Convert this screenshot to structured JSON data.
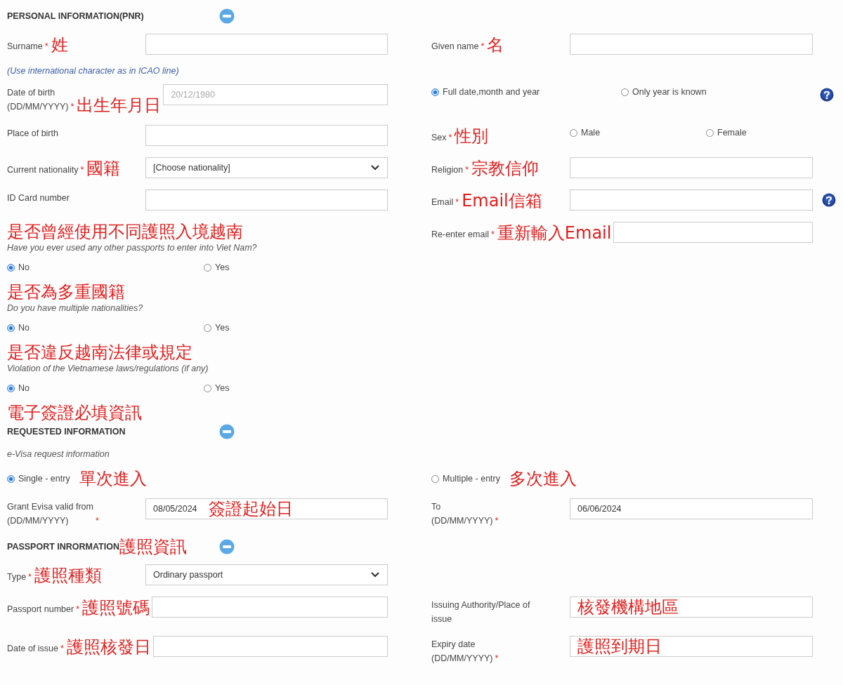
{
  "sections": [
    {
      "title": "PERSONAL INFORMATION(PNR)",
      "expanded": true,
      "rows": [
        {
          "kind": "pair",
          "cells": [
            {
              "kind": "input",
              "label": "Surname",
              "required_mark": "*",
              "note": "姓"
            },
            {
              "kind": "input",
              "label": "Given name",
              "required_mark": "*",
              "note": "名"
            }
          ]
        },
        {
          "kind": "info_hint",
          "text": "(Use international character as in ICAO line)"
        },
        {
          "kind": "pair",
          "cells": [
            {
              "kind": "input",
              "label": "Date of birth\n(DD/MM/YYYY)",
              "required_mark": "*",
              "note": "出生年月日",
              "placeholder": "20/12/1980"
            },
            {
              "kind": "choice",
              "help": true,
              "options": [
                {
                  "label": "Full date,month and year",
                  "selected": true
                },
                {
                  "label": "Only year is known",
                  "selected": false
                }
              ]
            }
          ]
        },
        {
          "kind": "pair",
          "cells": [
            {
              "kind": "input",
              "label": "Place of birth"
            },
            {
              "kind": "choice",
              "label": "Sex",
              "required_mark": "*",
              "note": "性別",
              "options": [
                {
                  "label": "Male",
                  "selected": false
                },
                {
                  "label": "Female",
                  "selected": false
                }
              ]
            }
          ]
        },
        {
          "kind": "pair",
          "cells": [
            {
              "kind": "select",
              "label": "Current nationality",
              "required_mark": "*",
              "note": "國籍",
              "value": "[Choose nationality]"
            },
            {
              "kind": "input",
              "label": "Religion",
              "required_mark": "*",
              "note": "宗教信仰"
            }
          ]
        },
        {
          "kind": "pair",
          "cells": [
            {
              "kind": "input",
              "label": "ID Card number"
            },
            {
              "kind": "input",
              "label": "Email",
              "required_mark": "*",
              "note": "Email信箱",
              "help": true
            }
          ]
        },
        {
          "kind": "pair",
          "cells": [
            {
              "kind": "question",
              "note": "是否曾經使用不同護照入境越南",
              "text": "Have you ever used any other passports to enter into Viet Nam?",
              "options": [
                {
                  "label": "No",
                  "selected": true
                },
                {
                  "label": "Yes",
                  "selected": false
                }
              ]
            },
            {
              "kind": "input",
              "label": "Re-enter email",
              "required_mark": "*",
              "note": "重新輸入Email"
            }
          ]
        },
        {
          "kind": "pair",
          "cells": [
            {
              "kind": "question",
              "note": "是否為多重國籍",
              "text": "Do you have multiple nationalities?",
              "options": [
                {
                  "label": "No",
                  "selected": true
                },
                {
                  "label": "Yes",
                  "selected": false
                }
              ]
            }
          ]
        },
        {
          "kind": "pair",
          "cells": [
            {
              "kind": "question",
              "note": "是否違反越南法律或規定",
              "text": "Violation of the Vietnamese laws/regulations (if any)",
              "options": [
                {
                  "label": "No",
                  "selected": true
                },
                {
                  "label": "Yes",
                  "selected": false
                }
              ]
            }
          ]
        },
        {
          "kind": "annotation",
          "text": "電子簽證必填資訊"
        }
      ]
    },
    {
      "title": "REQUESTED INFORMATION",
      "expanded": true,
      "rows": [
        {
          "kind": "subheading",
          "text": "e-Visa request information"
        },
        {
          "kind": "pair",
          "cells": [
            {
              "kind": "choice",
              "options": [
                {
                  "label": "Single - entry",
                  "selected": true,
                  "note": "單次進入"
                }
              ]
            },
            {
              "kind": "choice",
              "options": [
                {
                  "label": "Multiple - entry",
                  "selected": false,
                  "note": "多次進入"
                }
              ]
            }
          ]
        },
        {
          "kind": "pair",
          "cells": [
            {
              "kind": "input",
              "label": "Grant Evisa valid from\n(DD/MM/YYYY)",
              "required_mark": "*",
              "value": "08/05/2024",
              "field_note": "簽證起始日"
            },
            {
              "kind": "input",
              "label": "To\n(DD/MM/YYYY)",
              "required_mark": "*",
              "value": "06/06/2024"
            }
          ]
        }
      ]
    },
    {
      "title": "PASSPORT INRORMATION",
      "note": "護照資訊",
      "expanded": true,
      "rows": [
        {
          "kind": "pair",
          "cells": [
            {
              "kind": "select",
              "label": "Type",
              "required_mark": "*",
              "note": "護照種類",
              "value": "Ordinary passport"
            }
          ]
        },
        {
          "kind": "pair",
          "cells": [
            {
              "kind": "input",
              "label": "Passport number",
              "required_mark": "*",
              "note": "護照號碼"
            },
            {
              "kind": "input",
              "label": "Issuing Authority/Place of\nissue",
              "field_note": "核發機構地區"
            }
          ]
        },
        {
          "kind": "pair",
          "cells": [
            {
              "kind": "input",
              "label": "Date of issue",
              "required_mark": "*",
              "note": "護照核發日"
            },
            {
              "kind": "input",
              "label": "Expiry date\n(DD/MM/YYYY)",
              "required_mark": "*",
              "field_note": "護照到期日"
            }
          ]
        }
      ]
    }
  ]
}
